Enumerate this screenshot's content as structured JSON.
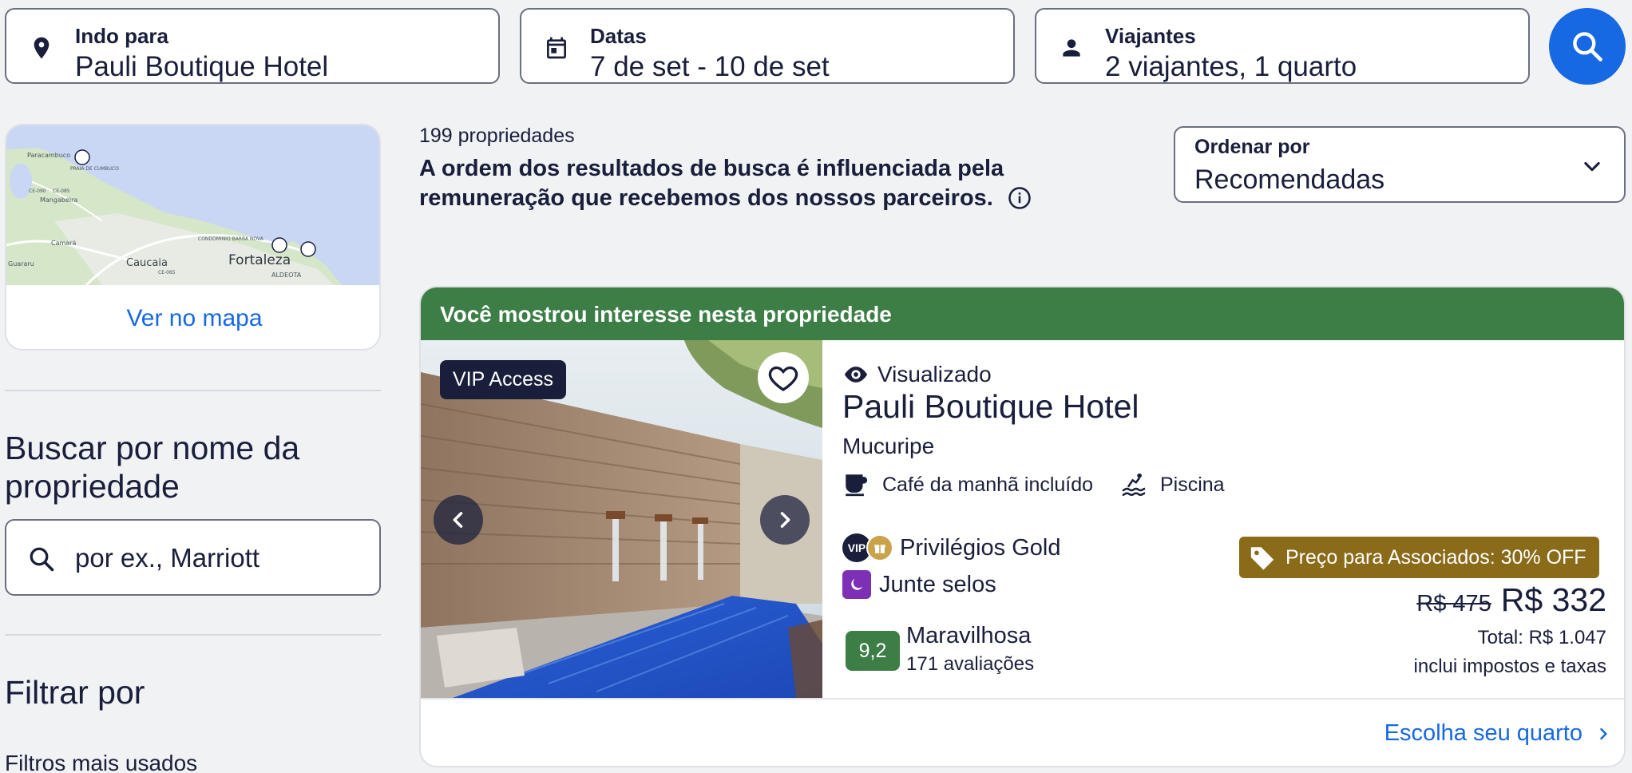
{
  "search": {
    "destination": {
      "label": "Indo para",
      "value": "Pauli Boutique Hotel",
      "icon": "location-pin-icon"
    },
    "dates": {
      "label": "Datas",
      "value": "7 de set - 10 de set",
      "icon": "calendar-icon"
    },
    "travelers": {
      "label": "Viajantes",
      "value": "2 viajantes, 1 quarto",
      "icon": "person-icon"
    },
    "button_icon": "search-icon",
    "accent": "#1668e3"
  },
  "map": {
    "link_label": "Ver no mapa",
    "place_labels": [
      "Paracambuco",
      "PRAIA DE CUMBUCO",
      "Mangabeira",
      "Camará",
      "Caucaia",
      "Fortaleza",
      "CONDOMINIO BARRA NOVA",
      "ALDEOTA",
      "Guararu",
      "CE-090",
      "CE-085",
      "CE-065"
    ]
  },
  "sidebar": {
    "name_search_title": "Buscar por nome da propriedade",
    "name_search_placeholder": "por ex., Marriott",
    "filter_title": "Filtrar por",
    "popular_filters": "Filtros mais usados"
  },
  "results": {
    "count": "199 propriedades",
    "disclaimer": "A ordem dos resultados de busca é influenciada pela remuneração que recebemos dos nossos parceiros.",
    "sort": {
      "label": "Ordenar por",
      "value": "Recomendadas"
    }
  },
  "card": {
    "banner": "Você mostrou interesse nesta propriedade",
    "banner_color": "#3c7e45",
    "vip_tag": "VIP Access",
    "viewed": "Visualizado",
    "name": "Pauli Boutique Hotel",
    "location": "Mucuripe",
    "amenities": [
      {
        "label": "Café da manhã incluído",
        "icon": "coffee-cup-icon"
      },
      {
        "label": "Piscina",
        "icon": "pool-icon"
      }
    ],
    "privileges": "Privilégios Gold",
    "vip_badge": "VIP",
    "stamps": "Junte selos",
    "rating": {
      "score": "9,2",
      "word": "Maravilhosa",
      "count": "171 avaliações"
    },
    "deal": {
      "label": "Preço para Associados: 30% OFF",
      "color": "#8a6b19"
    },
    "old_price": "R$ 475",
    "price": "R$ 332",
    "total": "Total: R$ 1.047",
    "taxes": "inclui impostos e taxas",
    "cta": "Escolha seu quarto"
  }
}
